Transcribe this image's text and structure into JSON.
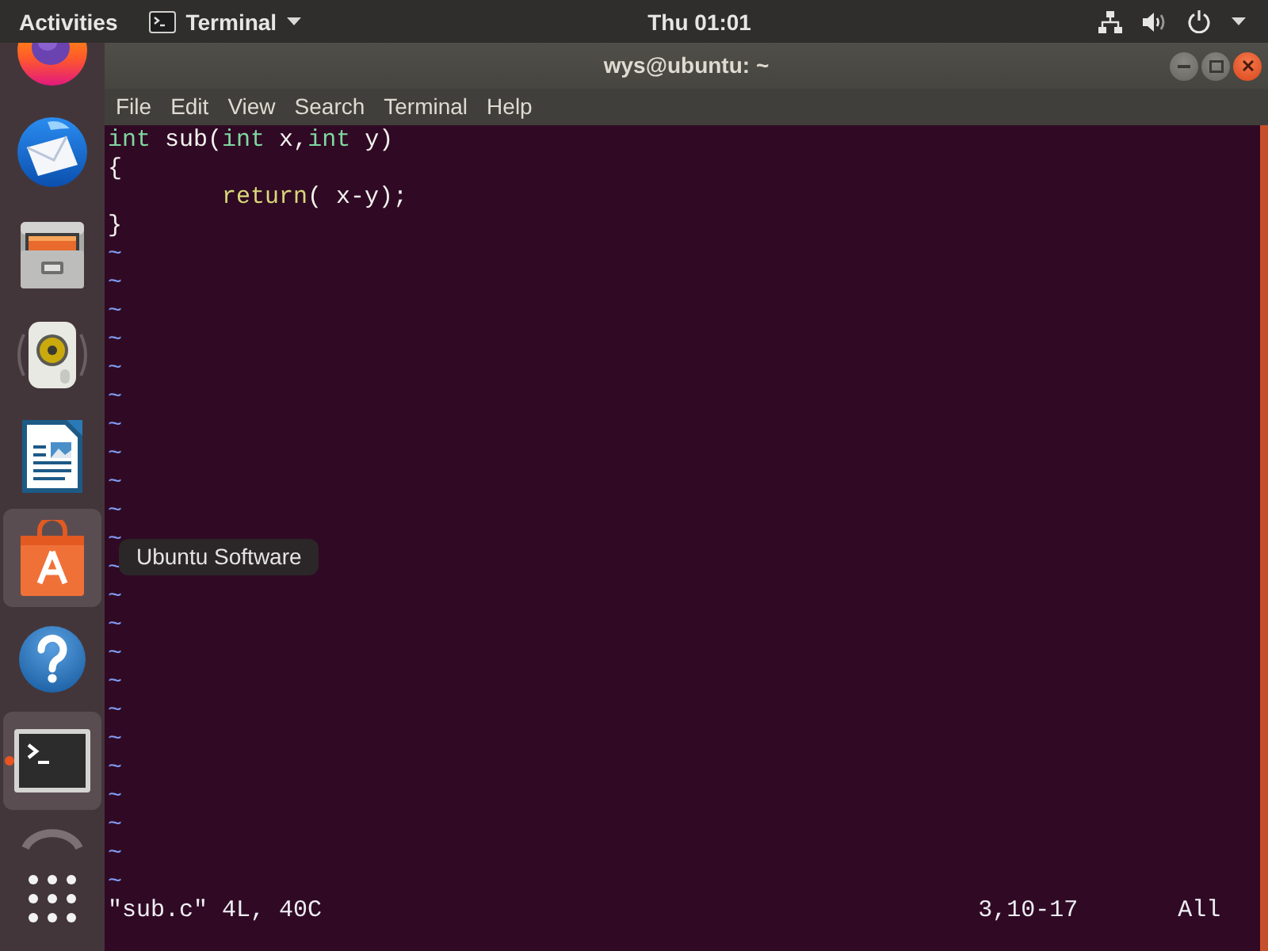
{
  "top_bar": {
    "activities": "Activities",
    "app_menu": "Terminal",
    "clock": "Thu 01:01"
  },
  "dock": {
    "items": [
      {
        "kind": "browser",
        "highlighted": false,
        "running": false
      },
      {
        "kind": "mail",
        "highlighted": false,
        "running": false
      },
      {
        "kind": "files",
        "highlighted": false,
        "running": false
      },
      {
        "kind": "music",
        "highlighted": false,
        "running": false
      },
      {
        "kind": "writer",
        "highlighted": false,
        "running": false
      },
      {
        "kind": "store",
        "highlighted": true,
        "running": false
      },
      {
        "kind": "help",
        "highlighted": false,
        "running": false
      },
      {
        "kind": "terminal",
        "highlighted": true,
        "running": true
      },
      {
        "kind": "faded",
        "highlighted": false,
        "running": false
      }
    ],
    "tooltip": "Ubuntu Software"
  },
  "window": {
    "title": "wys@ubuntu: ~",
    "menu": [
      "File",
      "Edit",
      "View",
      "Search",
      "Terminal",
      "Help"
    ]
  },
  "editor": {
    "lines": [
      {
        "tokens": [
          {
            "text": "int",
            "kind": "type"
          },
          {
            "text": " sub(",
            "kind": "plain"
          },
          {
            "text": "int",
            "kind": "type"
          },
          {
            "text": " x,",
            "kind": "plain"
          },
          {
            "text": "int",
            "kind": "type"
          },
          {
            "text": " y)",
            "kind": "plain"
          }
        ]
      },
      {
        "tokens": [
          {
            "text": "{",
            "kind": "plain"
          }
        ]
      },
      {
        "tokens": [
          {
            "text": "\treturn",
            "kind": "statement"
          },
          {
            "text": "( x-y);",
            "kind": "plain"
          }
        ]
      },
      {
        "tokens": [
          {
            "text": "}",
            "kind": "plain"
          }
        ]
      }
    ],
    "filler_lines": [
      "~",
      "~",
      "~",
      "~",
      "~",
      "~",
      "~",
      "~",
      "~",
      "~",
      "~",
      "~",
      "~",
      "~",
      "~",
      "~",
      "~",
      "~",
      "~",
      "~",
      "~",
      "~",
      "~"
    ],
    "status": {
      "message": "\"sub.c\" 4L, 40C",
      "cursor": "3,10-17",
      "scroll": "All"
    }
  }
}
